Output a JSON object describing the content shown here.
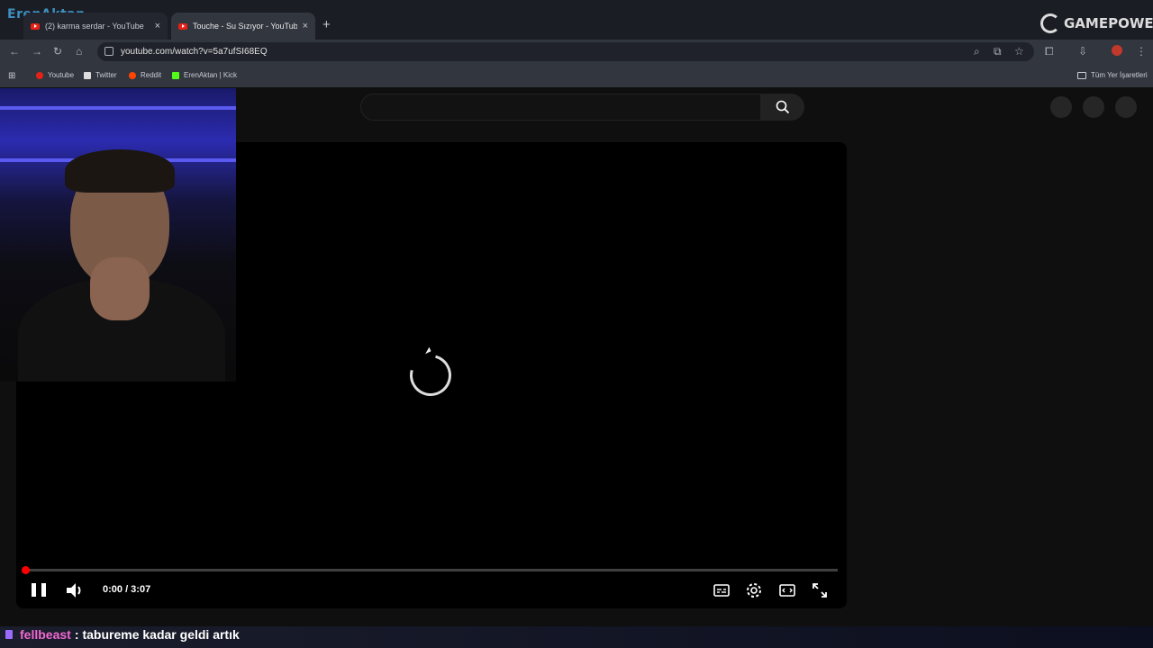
{
  "browser": {
    "tabs": [
      {
        "label": "(2) karma serdar - YouTube",
        "active": false
      },
      {
        "label": "Touche - Su Sızıyor - YouTube",
        "active": true
      }
    ],
    "close_glyph": "×",
    "new_tab_glyph": "+",
    "url": "youtube.com/watch?v=5a7ufSI68EQ",
    "bookmarks": [
      {
        "label": "Youtube",
        "color": "#e62117"
      },
      {
        "label": "Twitter",
        "color": "#ffffff"
      },
      {
        "label": "Reddit",
        "color": "#ff4500"
      },
      {
        "label": "ErenAktan | Kick",
        "color": "#53fc18"
      }
    ],
    "all_bookmarks_label": "Tüm Yer İşaretleri"
  },
  "overlay": {
    "streamer_logo": "ErenAktan",
    "sponsor_logo": "GAMEPOWER",
    "chat": {
      "user": "fellbeast",
      "separator": ":",
      "message": "tabureme kadar geldi artık"
    }
  },
  "player": {
    "current_time": "0:00",
    "duration": "3:07",
    "time_display": "0:00 / 3:07",
    "progress": 0.0,
    "state": "loading"
  },
  "colors": {
    "accent": "#ff0000",
    "page_bg": "#0f0f0f",
    "chrome_bg": "#32363f"
  }
}
